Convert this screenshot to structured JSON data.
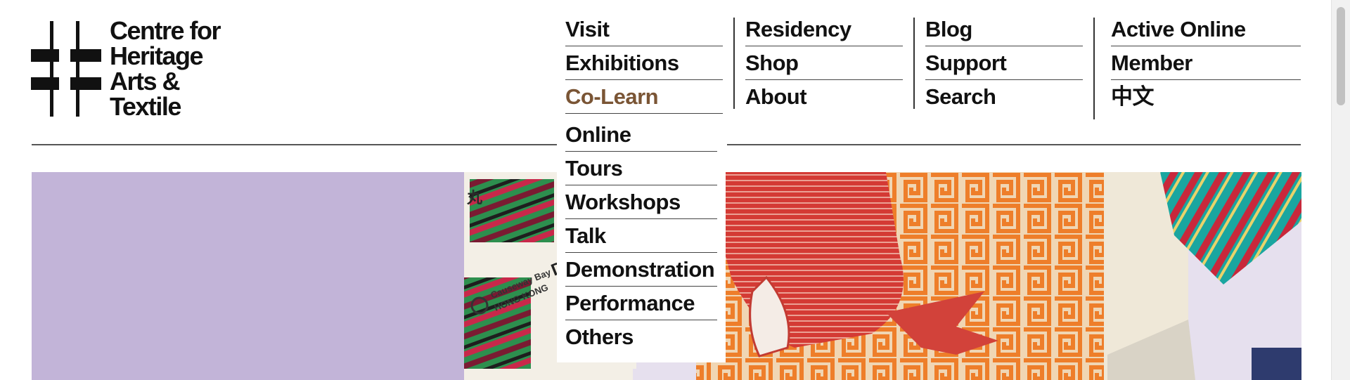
{
  "logo": {
    "lines": [
      "Centre for",
      "Heritage",
      "Arts &",
      "Textile"
    ]
  },
  "nav": {
    "columns": [
      {
        "items": [
          {
            "label": "Visit"
          },
          {
            "label": "Exhibitions"
          },
          {
            "label": "Co-Learn"
          }
        ]
      },
      {
        "items": [
          {
            "label": "Residency"
          },
          {
            "label": "Shop"
          },
          {
            "label": "About"
          }
        ]
      },
      {
        "items": [
          {
            "label": "Blog"
          },
          {
            "label": "Support"
          },
          {
            "label": "Search"
          }
        ]
      },
      {
        "items": [
          {
            "label": "Active Online"
          },
          {
            "label": "Member"
          },
          {
            "label": "中文"
          }
        ]
      }
    ],
    "active_item": "Co-Learn",
    "active_color": "#7a5535"
  },
  "colearn_submenu": {
    "items": [
      {
        "label": "Online"
      },
      {
        "label": "Tours"
      },
      {
        "label": "Workshops"
      },
      {
        "label": "Talk"
      },
      {
        "label": "Demonstration"
      },
      {
        "label": "Performance"
      },
      {
        "label": "Others"
      }
    ]
  },
  "hero": {
    "left_panel_color": "#c2b4d8",
    "image_description": "textile-collage-image",
    "ticket_text": [
      "Causeway Bay",
      "HONG KONG",
      "DA",
      "丸"
    ]
  }
}
